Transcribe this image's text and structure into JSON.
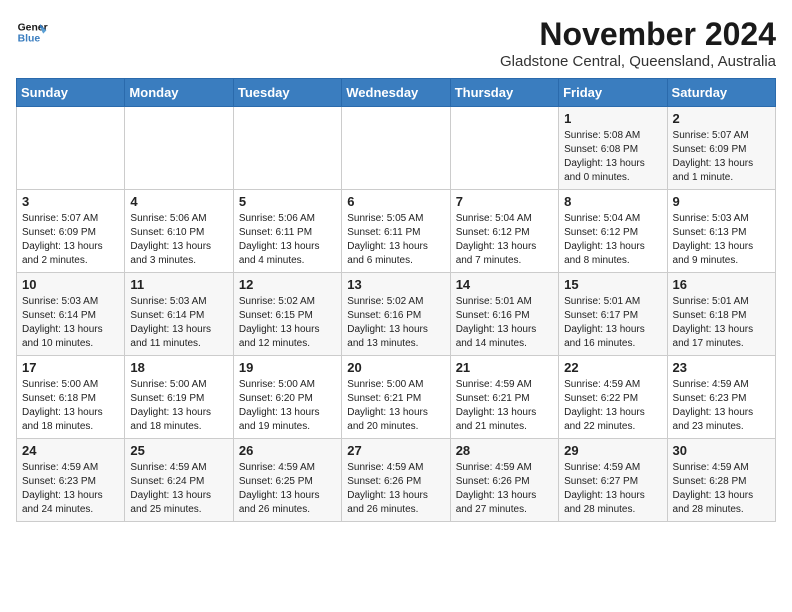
{
  "logo": {
    "line1": "General",
    "line2": "Blue"
  },
  "title": "November 2024",
  "location": "Gladstone Central, Queensland, Australia",
  "weekdays": [
    "Sunday",
    "Monday",
    "Tuesday",
    "Wednesday",
    "Thursday",
    "Friday",
    "Saturday"
  ],
  "weeks": [
    [
      {
        "day": "",
        "sunrise": "",
        "sunset": "",
        "daylight": ""
      },
      {
        "day": "",
        "sunrise": "",
        "sunset": "",
        "daylight": ""
      },
      {
        "day": "",
        "sunrise": "",
        "sunset": "",
        "daylight": ""
      },
      {
        "day": "",
        "sunrise": "",
        "sunset": "",
        "daylight": ""
      },
      {
        "day": "",
        "sunrise": "",
        "sunset": "",
        "daylight": ""
      },
      {
        "day": "1",
        "sunrise": "Sunrise: 5:08 AM",
        "sunset": "Sunset: 6:08 PM",
        "daylight": "Daylight: 13 hours and 0 minutes."
      },
      {
        "day": "2",
        "sunrise": "Sunrise: 5:07 AM",
        "sunset": "Sunset: 6:09 PM",
        "daylight": "Daylight: 13 hours and 1 minute."
      }
    ],
    [
      {
        "day": "3",
        "sunrise": "Sunrise: 5:07 AM",
        "sunset": "Sunset: 6:09 PM",
        "daylight": "Daylight: 13 hours and 2 minutes."
      },
      {
        "day": "4",
        "sunrise": "Sunrise: 5:06 AM",
        "sunset": "Sunset: 6:10 PM",
        "daylight": "Daylight: 13 hours and 3 minutes."
      },
      {
        "day": "5",
        "sunrise": "Sunrise: 5:06 AM",
        "sunset": "Sunset: 6:11 PM",
        "daylight": "Daylight: 13 hours and 4 minutes."
      },
      {
        "day": "6",
        "sunrise": "Sunrise: 5:05 AM",
        "sunset": "Sunset: 6:11 PM",
        "daylight": "Daylight: 13 hours and 6 minutes."
      },
      {
        "day": "7",
        "sunrise": "Sunrise: 5:04 AM",
        "sunset": "Sunset: 6:12 PM",
        "daylight": "Daylight: 13 hours and 7 minutes."
      },
      {
        "day": "8",
        "sunrise": "Sunrise: 5:04 AM",
        "sunset": "Sunset: 6:12 PM",
        "daylight": "Daylight: 13 hours and 8 minutes."
      },
      {
        "day": "9",
        "sunrise": "Sunrise: 5:03 AM",
        "sunset": "Sunset: 6:13 PM",
        "daylight": "Daylight: 13 hours and 9 minutes."
      }
    ],
    [
      {
        "day": "10",
        "sunrise": "Sunrise: 5:03 AM",
        "sunset": "Sunset: 6:14 PM",
        "daylight": "Daylight: 13 hours and 10 minutes."
      },
      {
        "day": "11",
        "sunrise": "Sunrise: 5:03 AM",
        "sunset": "Sunset: 6:14 PM",
        "daylight": "Daylight: 13 hours and 11 minutes."
      },
      {
        "day": "12",
        "sunrise": "Sunrise: 5:02 AM",
        "sunset": "Sunset: 6:15 PM",
        "daylight": "Daylight: 13 hours and 12 minutes."
      },
      {
        "day": "13",
        "sunrise": "Sunrise: 5:02 AM",
        "sunset": "Sunset: 6:16 PM",
        "daylight": "Daylight: 13 hours and 13 minutes."
      },
      {
        "day": "14",
        "sunrise": "Sunrise: 5:01 AM",
        "sunset": "Sunset: 6:16 PM",
        "daylight": "Daylight: 13 hours and 14 minutes."
      },
      {
        "day": "15",
        "sunrise": "Sunrise: 5:01 AM",
        "sunset": "Sunset: 6:17 PM",
        "daylight": "Daylight: 13 hours and 16 minutes."
      },
      {
        "day": "16",
        "sunrise": "Sunrise: 5:01 AM",
        "sunset": "Sunset: 6:18 PM",
        "daylight": "Daylight: 13 hours and 17 minutes."
      }
    ],
    [
      {
        "day": "17",
        "sunrise": "Sunrise: 5:00 AM",
        "sunset": "Sunset: 6:18 PM",
        "daylight": "Daylight: 13 hours and 18 minutes."
      },
      {
        "day": "18",
        "sunrise": "Sunrise: 5:00 AM",
        "sunset": "Sunset: 6:19 PM",
        "daylight": "Daylight: 13 hours and 18 minutes."
      },
      {
        "day": "19",
        "sunrise": "Sunrise: 5:00 AM",
        "sunset": "Sunset: 6:20 PM",
        "daylight": "Daylight: 13 hours and 19 minutes."
      },
      {
        "day": "20",
        "sunrise": "Sunrise: 5:00 AM",
        "sunset": "Sunset: 6:21 PM",
        "daylight": "Daylight: 13 hours and 20 minutes."
      },
      {
        "day": "21",
        "sunrise": "Sunrise: 4:59 AM",
        "sunset": "Sunset: 6:21 PM",
        "daylight": "Daylight: 13 hours and 21 minutes."
      },
      {
        "day": "22",
        "sunrise": "Sunrise: 4:59 AM",
        "sunset": "Sunset: 6:22 PM",
        "daylight": "Daylight: 13 hours and 22 minutes."
      },
      {
        "day": "23",
        "sunrise": "Sunrise: 4:59 AM",
        "sunset": "Sunset: 6:23 PM",
        "daylight": "Daylight: 13 hours and 23 minutes."
      }
    ],
    [
      {
        "day": "24",
        "sunrise": "Sunrise: 4:59 AM",
        "sunset": "Sunset: 6:23 PM",
        "daylight": "Daylight: 13 hours and 24 minutes."
      },
      {
        "day": "25",
        "sunrise": "Sunrise: 4:59 AM",
        "sunset": "Sunset: 6:24 PM",
        "daylight": "Daylight: 13 hours and 25 minutes."
      },
      {
        "day": "26",
        "sunrise": "Sunrise: 4:59 AM",
        "sunset": "Sunset: 6:25 PM",
        "daylight": "Daylight: 13 hours and 26 minutes."
      },
      {
        "day": "27",
        "sunrise": "Sunrise: 4:59 AM",
        "sunset": "Sunset: 6:26 PM",
        "daylight": "Daylight: 13 hours and 26 minutes."
      },
      {
        "day": "28",
        "sunrise": "Sunrise: 4:59 AM",
        "sunset": "Sunset: 6:26 PM",
        "daylight": "Daylight: 13 hours and 27 minutes."
      },
      {
        "day": "29",
        "sunrise": "Sunrise: 4:59 AM",
        "sunset": "Sunset: 6:27 PM",
        "daylight": "Daylight: 13 hours and 28 minutes."
      },
      {
        "day": "30",
        "sunrise": "Sunrise: 4:59 AM",
        "sunset": "Sunset: 6:28 PM",
        "daylight": "Daylight: 13 hours and 28 minutes."
      }
    ]
  ]
}
